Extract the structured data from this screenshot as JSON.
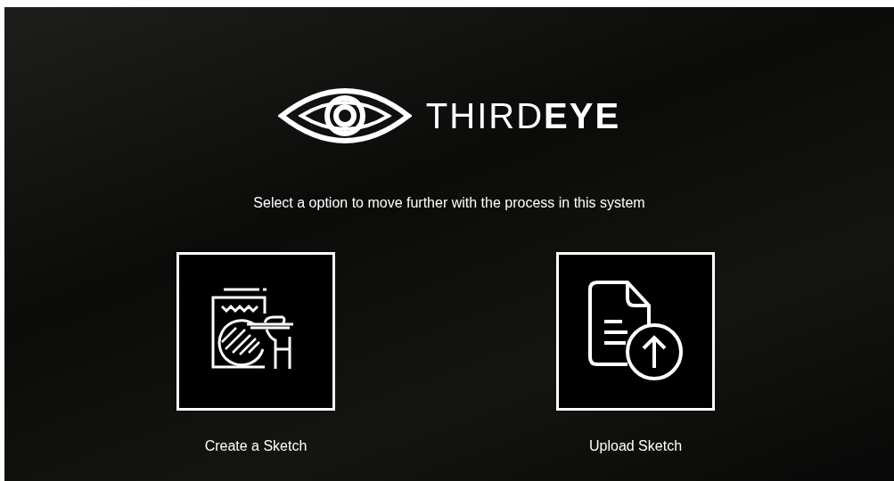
{
  "logo": {
    "wordmark": "THIRD**EYE**"
  },
  "prompt": "Select a option to move further with the process in this system",
  "options": [
    {
      "kind": "sketch",
      "label": "Create a Sketch"
    },
    {
      "kind": "upload",
      "label": "Upload Sketch"
    }
  ]
}
